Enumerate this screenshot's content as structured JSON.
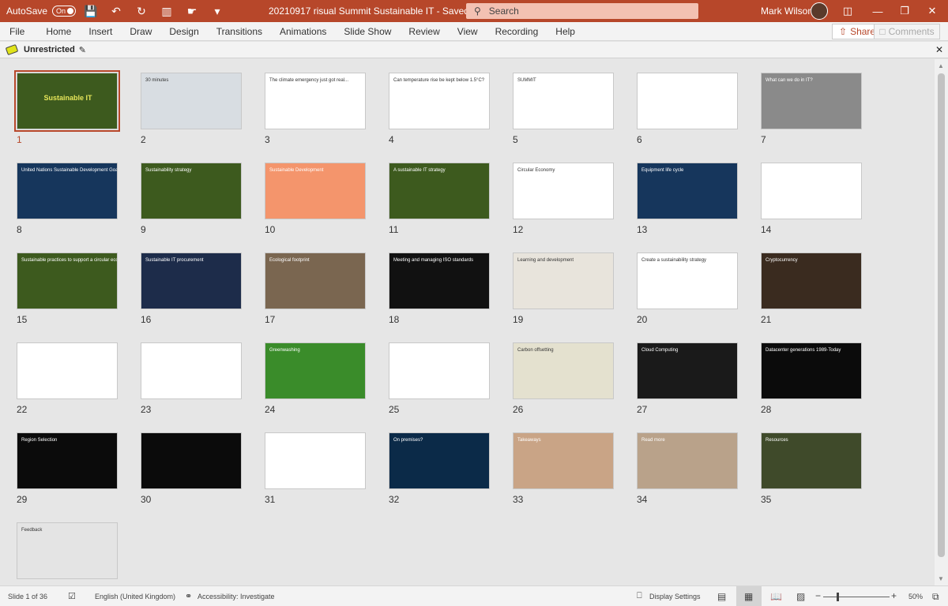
{
  "titlebar": {
    "autosave_label": "AutoSave",
    "autosave_state": "On",
    "document_title": "20210917 risual Summit Sustainable IT  -  Saved",
    "search_placeholder": "Search",
    "user_name": "Mark Wilson",
    "icons": [
      "save-icon",
      "undo-icon",
      "redo-icon",
      "present-icon",
      "touch-mode-icon",
      "customize-icon"
    ],
    "window_buttons": [
      "ribbon-display-icon",
      "minimize-icon",
      "restore-icon",
      "close-icon"
    ]
  },
  "menu": {
    "items": [
      "File",
      "Home",
      "Insert",
      "Draw",
      "Design",
      "Transitions",
      "Animations",
      "Slide Show",
      "Review",
      "View",
      "Recording",
      "Help"
    ],
    "share_label": "Share",
    "comments_label": "Comments"
  },
  "infobar": {
    "label": "Unrestricted"
  },
  "slides": [
    {
      "n": "1",
      "title": "Sustainable IT",
      "bg": "#3d5a1e"
    },
    {
      "n": "2",
      "title": "30 minutes",
      "bg": "#d8dde2"
    },
    {
      "n": "3",
      "title": "The climate emergency just got real...",
      "bg": "#ffffff"
    },
    {
      "n": "4",
      "title": "Can temperature rise be kept below 1.5°C?",
      "bg": "#ffffff"
    },
    {
      "n": "5",
      "title": "SUMMIT",
      "bg": "#ffffff"
    },
    {
      "n": "6",
      "title": "",
      "bg": "#ffffff"
    },
    {
      "n": "7",
      "title": "What can we do in IT?",
      "bg": "#8a8a8a"
    },
    {
      "n": "8",
      "title": "United Nations Sustainable Development Goals",
      "bg": "#16365c"
    },
    {
      "n": "9",
      "title": "Sustainability strategy",
      "bg": "#3d5a1e"
    },
    {
      "n": "10",
      "title": "Sustainable Development",
      "bg": "#f4956c"
    },
    {
      "n": "11",
      "title": "A sustainable IT strategy",
      "bg": "#3d5a1e"
    },
    {
      "n": "12",
      "title": "Circular Economy",
      "bg": "#ffffff"
    },
    {
      "n": "13",
      "title": "Equipment life cycle",
      "bg": "#16365c"
    },
    {
      "n": "14",
      "title": "",
      "bg": "#ffffff"
    },
    {
      "n": "15",
      "title": "Sustainable practices to support a circular economy",
      "bg": "#3d5a1e"
    },
    {
      "n": "16",
      "title": "Sustainable IT procurement",
      "bg": "#1d2c4a"
    },
    {
      "n": "17",
      "title": "Ecological footprint",
      "bg": "#7a6650"
    },
    {
      "n": "18",
      "title": "Meeting and managing ISO standards",
      "bg": "#111111"
    },
    {
      "n": "19",
      "title": "Learning and development",
      "bg": "#e8e4dc"
    },
    {
      "n": "20",
      "title": "Create a sustainability strategy",
      "bg": "#ffffff"
    },
    {
      "n": "21",
      "title": "Cryptocurrency",
      "bg": "#3a2b1f"
    },
    {
      "n": "22",
      "title": "",
      "bg": "#ffffff"
    },
    {
      "n": "23",
      "title": "",
      "bg": "#ffffff"
    },
    {
      "n": "24",
      "title": "Greenwashing",
      "bg": "#3a8c2a"
    },
    {
      "n": "25",
      "title": "",
      "bg": "#ffffff"
    },
    {
      "n": "26",
      "title": "Carbon offsetting",
      "bg": "#e4e1cf"
    },
    {
      "n": "27",
      "title": "Cloud Computing",
      "bg": "#1a1a1a"
    },
    {
      "n": "28",
      "title": "Datacenter generations 1989-Today",
      "bg": "#0b0b0b"
    },
    {
      "n": "29",
      "title": "Region Selection",
      "bg": "#0b0b0b"
    },
    {
      "n": "30",
      "title": "",
      "bg": "#0b0b0b"
    },
    {
      "n": "31",
      "title": "",
      "bg": "#ffffff"
    },
    {
      "n": "32",
      "title": "On premises?",
      "bg": "#0b2a48"
    },
    {
      "n": "33",
      "title": "Takeaways",
      "bg": "#c9a486"
    },
    {
      "n": "34",
      "title": "Read more",
      "bg": "#b9a28a"
    },
    {
      "n": "35",
      "title": "Resources",
      "bg": "#3f4a2a"
    },
    {
      "n": "36",
      "title": "Feedback",
      "bg": "#e4e4e4"
    }
  ],
  "status": {
    "slide_info": "Slide 1 of 36",
    "language": "English (United Kingdom)",
    "accessibility": "Accessibility: Investigate",
    "display_settings": "Display Settings",
    "zoom": "50%"
  }
}
